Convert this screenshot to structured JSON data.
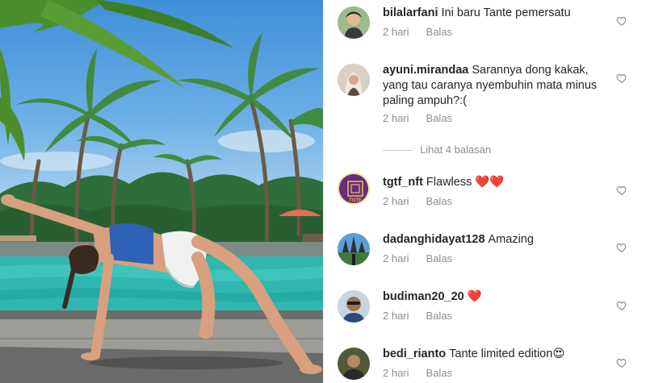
{
  "post": {
    "image_icon": "photo-yoga-pool"
  },
  "comments": [
    {
      "username": "bilalarfani",
      "text": "Ini baru Tante pemersatu",
      "time": "2 hari",
      "reply": "Balas"
    },
    {
      "username": "ayuni.mirandaa",
      "text": "Sarannya dong kakak, yang tau caranya nyembuhin mata minus paling ampuh?:(",
      "time": "2 hari",
      "reply": "Balas"
    },
    {
      "username": "tgtf_nft",
      "text": "Flawless",
      "emoji": "❤️❤️",
      "time": "2 hari",
      "reply": "Balas"
    },
    {
      "username": "dadanghidayat128",
      "text": "Amazing",
      "time": "2 hari",
      "reply": "Balas"
    },
    {
      "username": "budiman20_20",
      "text": "",
      "emoji": "❤️",
      "time": "2 hari",
      "reply": "Balas"
    },
    {
      "username": "bedi_rianto",
      "text": "Tante limited edition",
      "emoji": "😍",
      "time": "2 hari",
      "reply": "Balas"
    }
  ],
  "view_replies": "Lihat 4 balasan",
  "avatars": {
    "tgtf_nft_badge": "TGTF"
  },
  "colors": {
    "secondary_text": "#8e8e8e",
    "primary_text": "#262626",
    "heart_red": "#ed2b3a",
    "tgtf_purple": "#6a2a7e"
  }
}
